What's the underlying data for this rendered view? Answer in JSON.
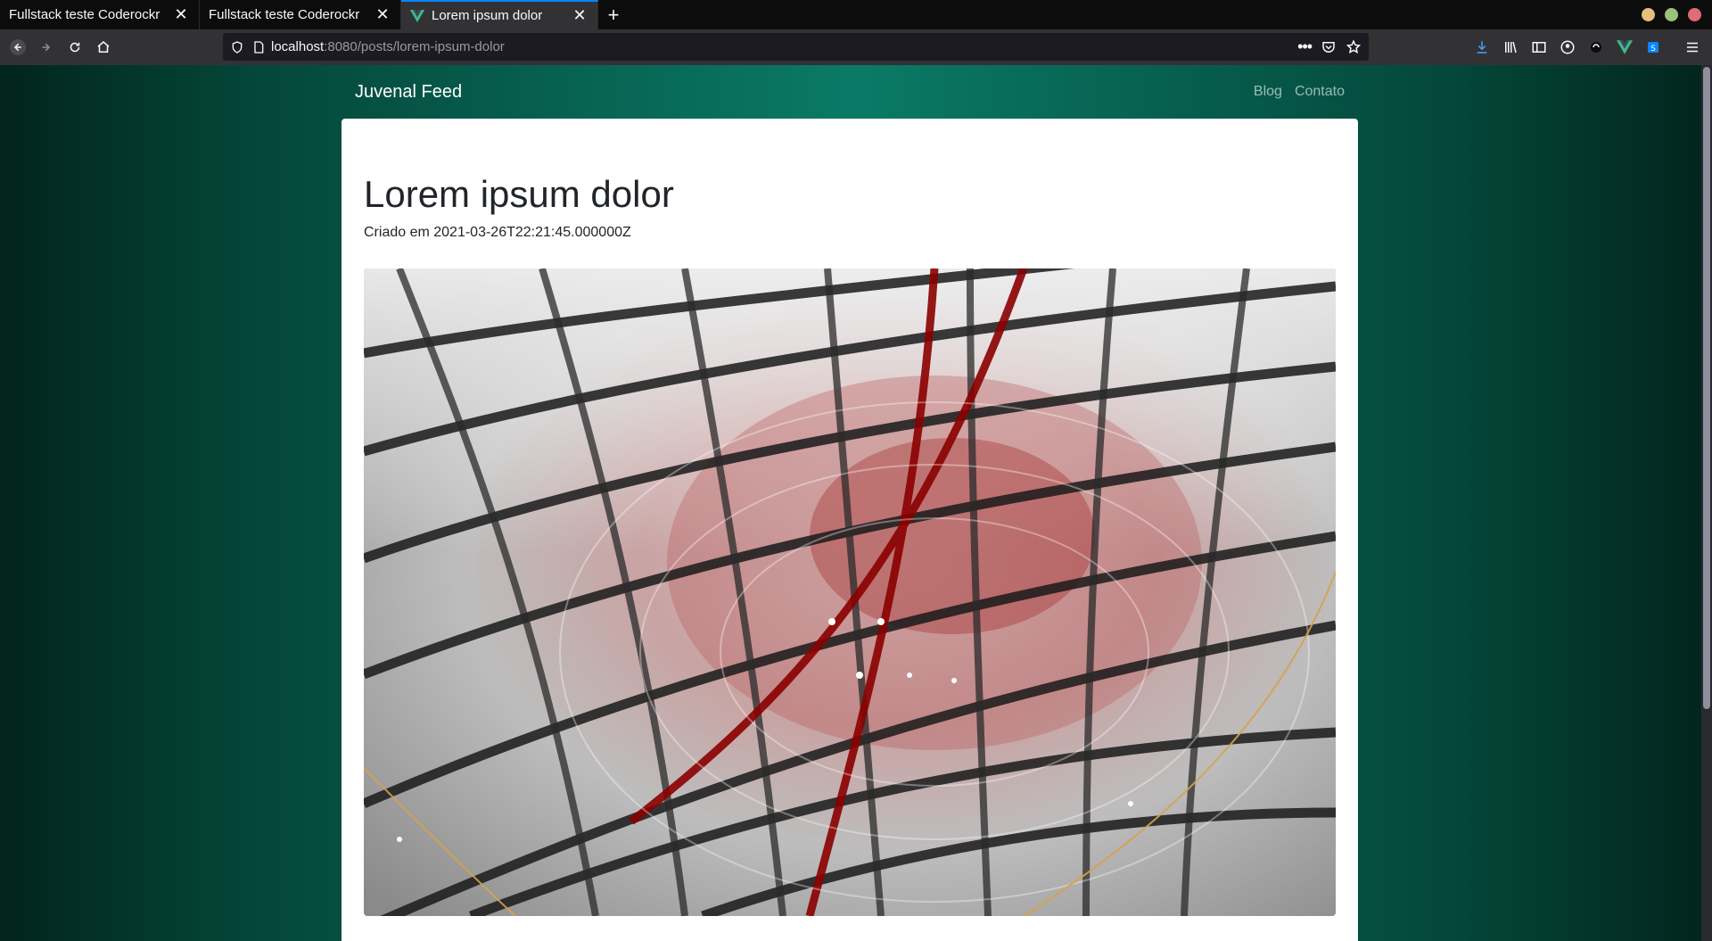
{
  "browser": {
    "tabs": [
      {
        "title": "Fullstack teste Coderockr",
        "active": false
      },
      {
        "title": "Fullstack teste Coderockr",
        "active": false
      },
      {
        "title": "Lorem ipsum dolor",
        "active": true
      }
    ],
    "url_host": "localhost",
    "url_rest": ":8080/posts/lorem-ipsum-dolor",
    "window_controls_colors": [
      "#e5c07b",
      "#98c379",
      "#e06c75"
    ],
    "accent": "#0a84ff"
  },
  "site": {
    "brand": "Juvenal Feed",
    "nav": [
      "Blog",
      "Contato"
    ]
  },
  "post": {
    "title": "Lorem ipsum dolor",
    "meta": "Criado em 2021-03-26T22:21:45.000000Z",
    "image_alt": "Abstract architectural ceiling with curved glass panels"
  },
  "colors": {
    "gradient_center": "#0a7a66",
    "gradient_edge": "#02241c",
    "card_bg": "#ffffff"
  }
}
